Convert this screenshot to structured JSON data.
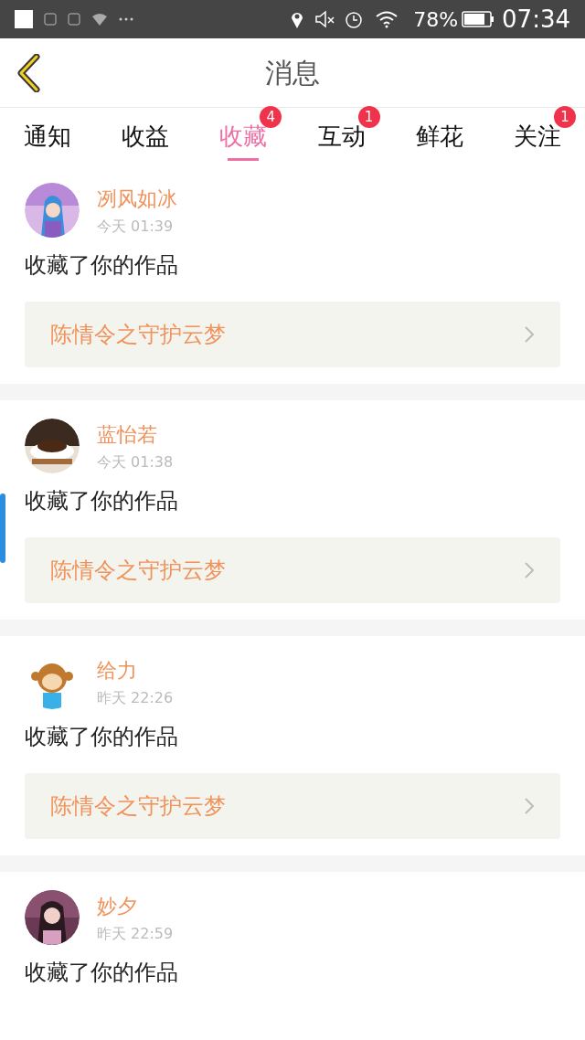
{
  "status_bar": {
    "battery": "78%",
    "time": "07:34"
  },
  "header": {
    "title": "消息"
  },
  "tabs": [
    {
      "label": "通知",
      "selected": false
    },
    {
      "label": "收益",
      "selected": false
    },
    {
      "label": "收藏",
      "selected": true,
      "badge": "4"
    },
    {
      "label": "互动",
      "selected": false,
      "badge": "1"
    },
    {
      "label": "鲜花",
      "selected": false
    },
    {
      "label": "关注",
      "selected": false,
      "badge": "1"
    }
  ],
  "messages": [
    {
      "name": "冽风如冰",
      "time": "今天 01:39",
      "text": "收藏了你的作品",
      "work": "陈情令之守护云梦",
      "highlighted": false
    },
    {
      "name": "蓝怡若",
      "time": "今天 01:38",
      "text": "收藏了你的作品",
      "work": "陈情令之守护云梦",
      "highlighted": true
    },
    {
      "name": "给力",
      "time": "昨天 22:26",
      "text": "收藏了你的作品",
      "work": "陈情令之守护云梦",
      "highlighted": false
    },
    {
      "name": "妙夕",
      "time": "昨天 22:59",
      "text": "收藏了你的作品",
      "highlighted": false
    }
  ]
}
